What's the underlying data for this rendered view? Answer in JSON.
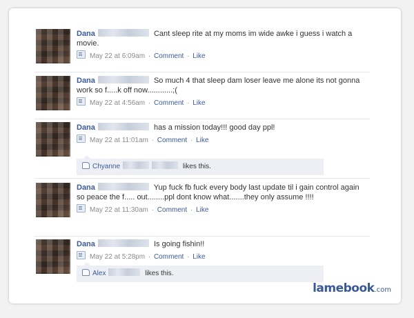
{
  "posts": [
    {
      "author": "Dana",
      "text": "Cant sleep rite at my moms im wide awke i guess i watch a movie.",
      "timestamp": "May 22 at 6:09am",
      "actions": {
        "comment": "Comment",
        "like": "Like"
      }
    },
    {
      "author": "Dana",
      "text": "So much 4 that sleep dam loser leave me alone its not gonna work so f.....k off now............;(",
      "timestamp": "May 22 at 4:56am",
      "actions": {
        "comment": "Comment",
        "like": "Like"
      }
    },
    {
      "author": "Dana",
      "text": "has a mission today!!! good day ppl!",
      "timestamp": "May 22 at 11:01am",
      "actions": {
        "comment": "Comment",
        "like": "Like"
      },
      "likes": {
        "liker": "Chyanne",
        "suffix": "likes this."
      }
    },
    {
      "author": "Dana",
      "text": "Yup fuck fb fuck every body last update til i gain control again so peace the f..... out........ppl dont know what.......they only assume !!!!",
      "timestamp": "May 22 at 11:30am",
      "actions": {
        "comment": "Comment",
        "like": "Like"
      }
    },
    {
      "author": "Dana",
      "text": "Is going fishin!!",
      "timestamp": "May 22 at 5:28pm",
      "actions": {
        "comment": "Comment",
        "like": "Like"
      },
      "likes": {
        "liker": "Alex",
        "suffix": "likes this."
      }
    }
  ],
  "separator": "·",
  "icons": {
    "post_meta": "status-quote-icon",
    "likes": "thumbs-up-icon",
    "avatar": "pixelated-avatar"
  },
  "brand": {
    "name": "lamebook",
    "tld": ".com"
  },
  "colors": {
    "link": "#3b5998",
    "meta": "#8a8a8a",
    "likes_bg": "#edeff4"
  }
}
